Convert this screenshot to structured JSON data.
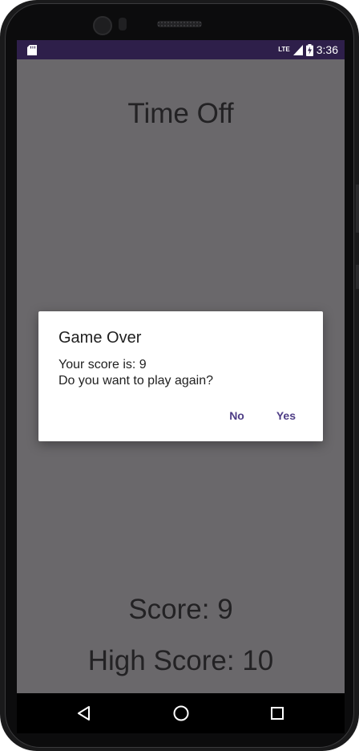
{
  "device": {
    "icons": [
      "camera-icon",
      "speaker-icon"
    ]
  },
  "status_bar": {
    "left_icon": "sd-card-icon",
    "network": "LTE",
    "signal_icon": "signal-icon",
    "battery_icon": "battery-charging-icon",
    "time": "3:36",
    "background": "#2e1f4a"
  },
  "screen": {
    "title": "Time Off",
    "score": "Score: 9",
    "high_score": "High Score: 10",
    "background": "#6a686b"
  },
  "dialog": {
    "title": "Game Over",
    "message_line1": "Your score is: 9",
    "message_line2": "Do you want to play again?",
    "negative_label": "No",
    "positive_label": "Yes",
    "accent": "#4e3d86"
  },
  "nav_bar": {
    "back_icon": "back-triangle-icon",
    "home_icon": "home-circle-icon",
    "recents_icon": "recents-square-icon"
  }
}
